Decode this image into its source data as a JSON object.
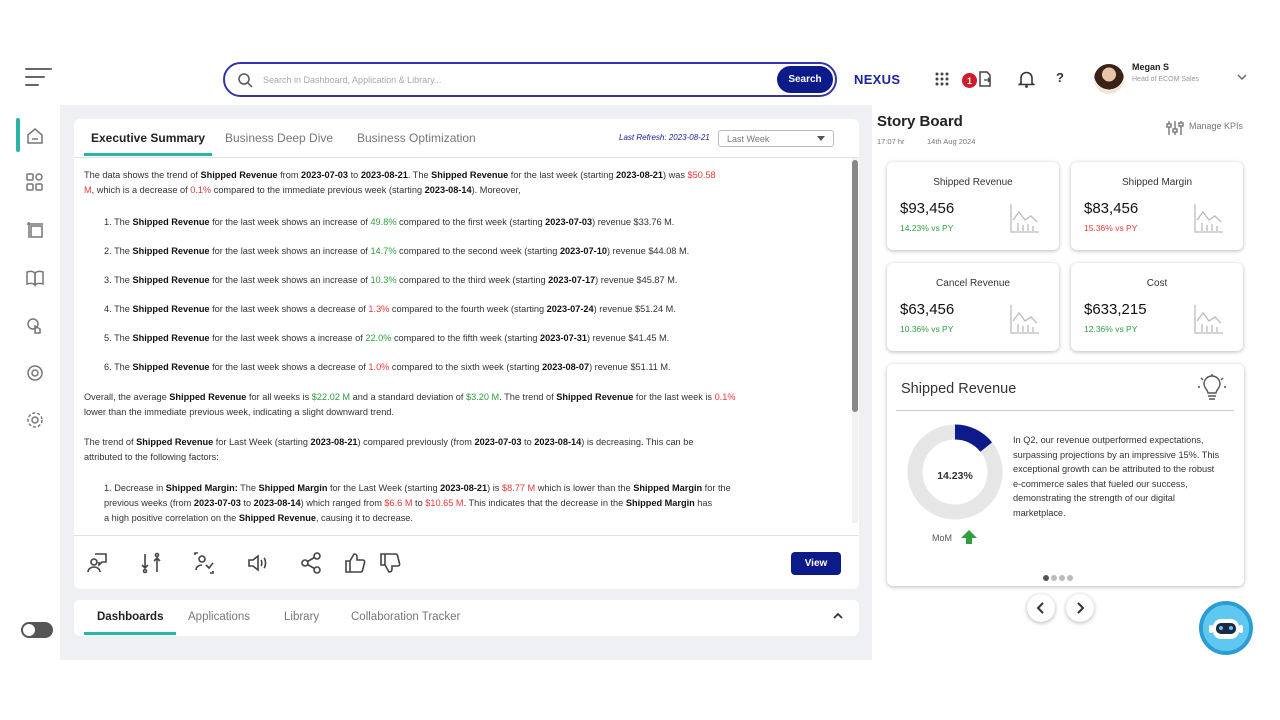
{
  "search": {
    "placeholder": "Search in Dashboard, Application & Library...",
    "button": "Search"
  },
  "brand": "NEXUS",
  "header": {
    "notification_count": "1",
    "help": "?"
  },
  "user": {
    "name": "Megan S",
    "role": "Head of ECOM Sales"
  },
  "main": {
    "tabs": [
      "Executive Summary",
      "Business Deep Dive",
      "Business Optimization"
    ],
    "last_refresh": "Last Refresh: 2023-08-21",
    "period_select": "Last Week",
    "view_button": "View"
  },
  "summary": {
    "intro": [
      "The data shows the trend of ",
      "Shipped Revenue",
      " from ",
      "2023-07-03",
      " to ",
      "2023-08-21",
      ". The ",
      "Shipped Revenue",
      " for the last week (starting ",
      "2023-08-21",
      ") was ",
      "$50.58",
      "M",
      ", which is a decrease of ",
      "0.1%",
      " compared to the immediate previous week (starting ",
      "2023-08-14",
      "). Moreover,"
    ],
    "items": [
      {
        "n": "1.",
        "dir": "shows an increase of",
        "pct": "49.8%",
        "color": "green",
        "ord": "first",
        "date": "2023-07-03",
        "rev": "$33.76 M."
      },
      {
        "n": "2.",
        "dir": "shows an increase of",
        "pct": "14.7%",
        "color": "green",
        "ord": "second",
        "date": "2023-07-10",
        "rev": "$44.08 M."
      },
      {
        "n": "3.",
        "dir": "shows an increase of",
        "pct": "10.3%",
        "color": "green",
        "ord": "third",
        "date": "2023-07-17",
        "rev": "$45.87 M."
      },
      {
        "n": "4.",
        "dir": "shows a decrease of",
        "pct": "1.3%",
        "color": "red",
        "ord": "fourth",
        "date": "2023-07-24",
        "rev": "$51.24 M."
      },
      {
        "n": "5.",
        "dir": "shows a increase of",
        "pct": "22.0%",
        "color": "green",
        "ord": "fifth",
        "date": "2023-07-31",
        "rev": "$41.45 M."
      },
      {
        "n": "6.",
        "dir": "shows a decrease of",
        "pct": "1.0%",
        "color": "red",
        "ord": "sixth",
        "date": "2023-08-07",
        "rev": "$51.11 M."
      }
    ],
    "item_parts": {
      "the": "The ",
      "metric": "Shipped Revenue",
      "for": " for the last week ",
      "compared": " compared to the ",
      "week_start": " week (starting ",
      "revenue": ") revenue "
    },
    "overall": [
      "Overall, the average ",
      "Shipped Revenue",
      " for all weeks is ",
      "$22.02 M",
      " and a standard deviation of ",
      "$3.20 M",
      ". The trend of ",
      "Shipped Revenue",
      " for the last week is ",
      "0.1%",
      "lower than the immediate previous week, indicating a slight downward trend."
    ],
    "trend": [
      "The trend of ",
      "Shipped Revenue",
      " for Last Week (starting ",
      "2023-08-21",
      ") compared previously (from ",
      "2023-07-03",
      " to ",
      "2023-08-14",
      ") is decreasing. This can be",
      "attributed to the following factors:"
    ],
    "factor": [
      "1. Decrease in ",
      "Shipped Margin:",
      " The ",
      "Shipped Margin",
      " for the Last Week (starting ",
      "2023-08-21",
      ") is ",
      "$8.77 M",
      " which is lower than the ",
      "Shipped Margin",
      " for the",
      "previous weeks (from ",
      "2023-07-03",
      " to ",
      "2023-08-14",
      ") which ranged from ",
      "$6.6 M",
      " to ",
      "$10.65 M",
      ". This indicates that the decrease in the ",
      "Shipped Margin",
      " has",
      "a high positive correlation on the ",
      "Shipped Revenue",
      ", causing it to decrease."
    ]
  },
  "bottom_tabs": [
    "Dashboards",
    "Applications",
    "Library",
    "Collaboration Tracker"
  ],
  "storyboard": {
    "title": "Story Board",
    "time": "17:07 hr",
    "date": "14th Aug 2024",
    "manage": "Manage KPIs",
    "kpis": [
      {
        "title": "Shipped Revenue",
        "value": "$93,456",
        "change": "14.23% vs PY",
        "status": "green"
      },
      {
        "title": "Shipped Margin",
        "value": "$83,456",
        "change": "15.36% vs PY",
        "status": "red"
      },
      {
        "title": "Cancel Revenue",
        "value": "$63,456",
        "change": "10.36% vs PY",
        "status": "green"
      },
      {
        "title": "Cost",
        "value": "$633,215",
        "change": "12.36% vs PY",
        "status": "green"
      }
    ],
    "insight": {
      "title": "Shipped Revenue",
      "donut_value": "14.23%",
      "donut_fraction": 0.1423,
      "mom": "MoM",
      "text": "In Q2, our revenue outperformed expectations, surpassing projections by an impressive 15%. This exceptional growth can be attributed to the robust e-commerce sales that fueled our success, demonstrating the strength of our digital marketplace."
    }
  },
  "colors": {
    "accent": "#2bb5a8",
    "brand_blue": "#0d1a8a",
    "positive": "#2e9e3e",
    "negative": "#e53935"
  }
}
